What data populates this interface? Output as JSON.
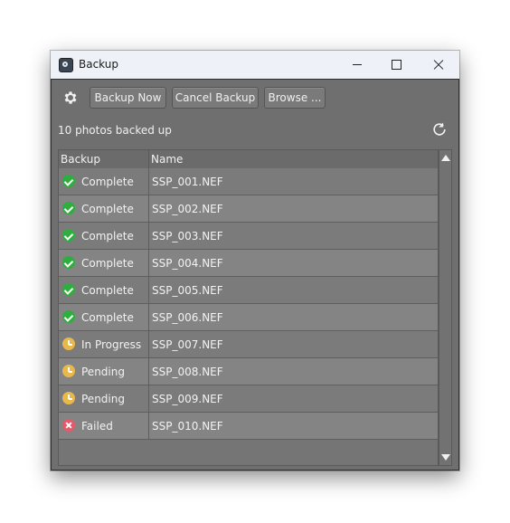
{
  "window": {
    "title": "Backup"
  },
  "toolbar": {
    "icon": "gear-icon",
    "backup_now_label": "Backup Now",
    "cancel_backup_label": "Cancel Backup",
    "browse_label": "Browse ..."
  },
  "status": {
    "text": "10 photos backed up"
  },
  "table": {
    "columns": [
      "Backup",
      "Name"
    ],
    "rows": [
      {
        "status": "Complete",
        "name": "SSP_001.NEF",
        "icon": "check-icon",
        "color": "#2fae3f"
      },
      {
        "status": "Complete",
        "name": "SSP_002.NEF",
        "icon": "check-icon",
        "color": "#2fae3f"
      },
      {
        "status": "Complete",
        "name": "SSP_003.NEF",
        "icon": "check-icon",
        "color": "#2fae3f"
      },
      {
        "status": "Complete",
        "name": "SSP_004.NEF",
        "icon": "check-icon",
        "color": "#2fae3f"
      },
      {
        "status": "Complete",
        "name": "SSP_005.NEF",
        "icon": "check-icon",
        "color": "#2fae3f"
      },
      {
        "status": "Complete",
        "name": "SSP_006.NEF",
        "icon": "check-icon",
        "color": "#2fae3f"
      },
      {
        "status": "In Progress",
        "name": "SSP_007.NEF",
        "icon": "clock-icon",
        "color": "#e8b84c"
      },
      {
        "status": "Pending",
        "name": "SSP_008.NEF",
        "icon": "clock-icon",
        "color": "#e8b84c"
      },
      {
        "status": "Pending",
        "name": "SSP_009.NEF",
        "icon": "clock-icon",
        "color": "#e8b84c"
      },
      {
        "status": "Failed",
        "name": "SSP_010.NEF",
        "icon": "x-icon",
        "color": "#e55a6a"
      }
    ]
  }
}
